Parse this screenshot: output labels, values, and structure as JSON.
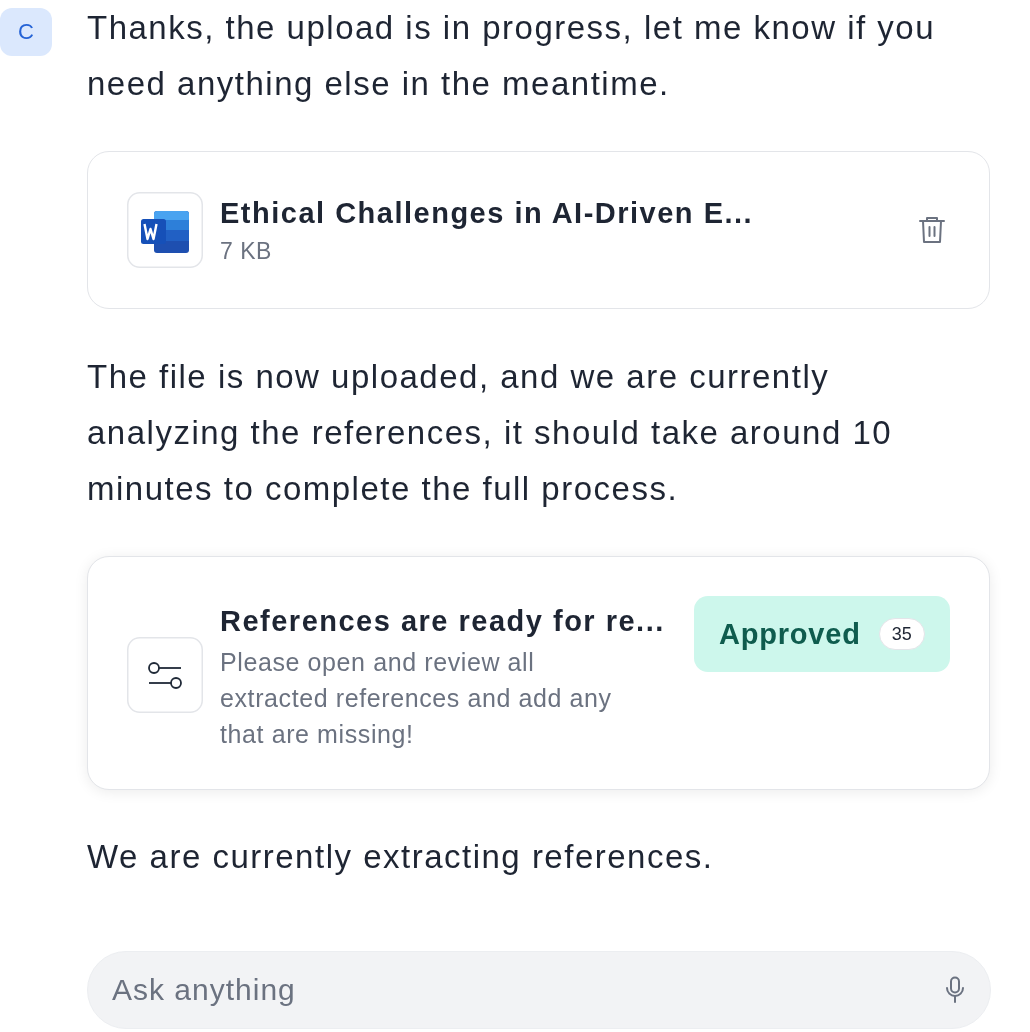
{
  "avatar": {
    "letter": "C"
  },
  "thread": [
    {
      "kind": "text",
      "text": "Thanks, the upload is in progress, let me know if you need anything else in the meantime."
    },
    {
      "kind": "file",
      "name": "Ethical Challenges in AI-Driven E...",
      "size": "7 KB"
    },
    {
      "kind": "text",
      "text": "The file is now uploaded, and we are currently analyzing the references, it should take around 10 minutes to complete the full process."
    },
    {
      "kind": "task",
      "title": "References are ready for re...",
      "description": "Please open and review all extracted references and add any that are missing!",
      "status": "Approved",
      "count": "35"
    },
    {
      "kind": "text",
      "text": "We are currently extracting references."
    }
  ],
  "composer": {
    "placeholder": "Ask anything"
  }
}
